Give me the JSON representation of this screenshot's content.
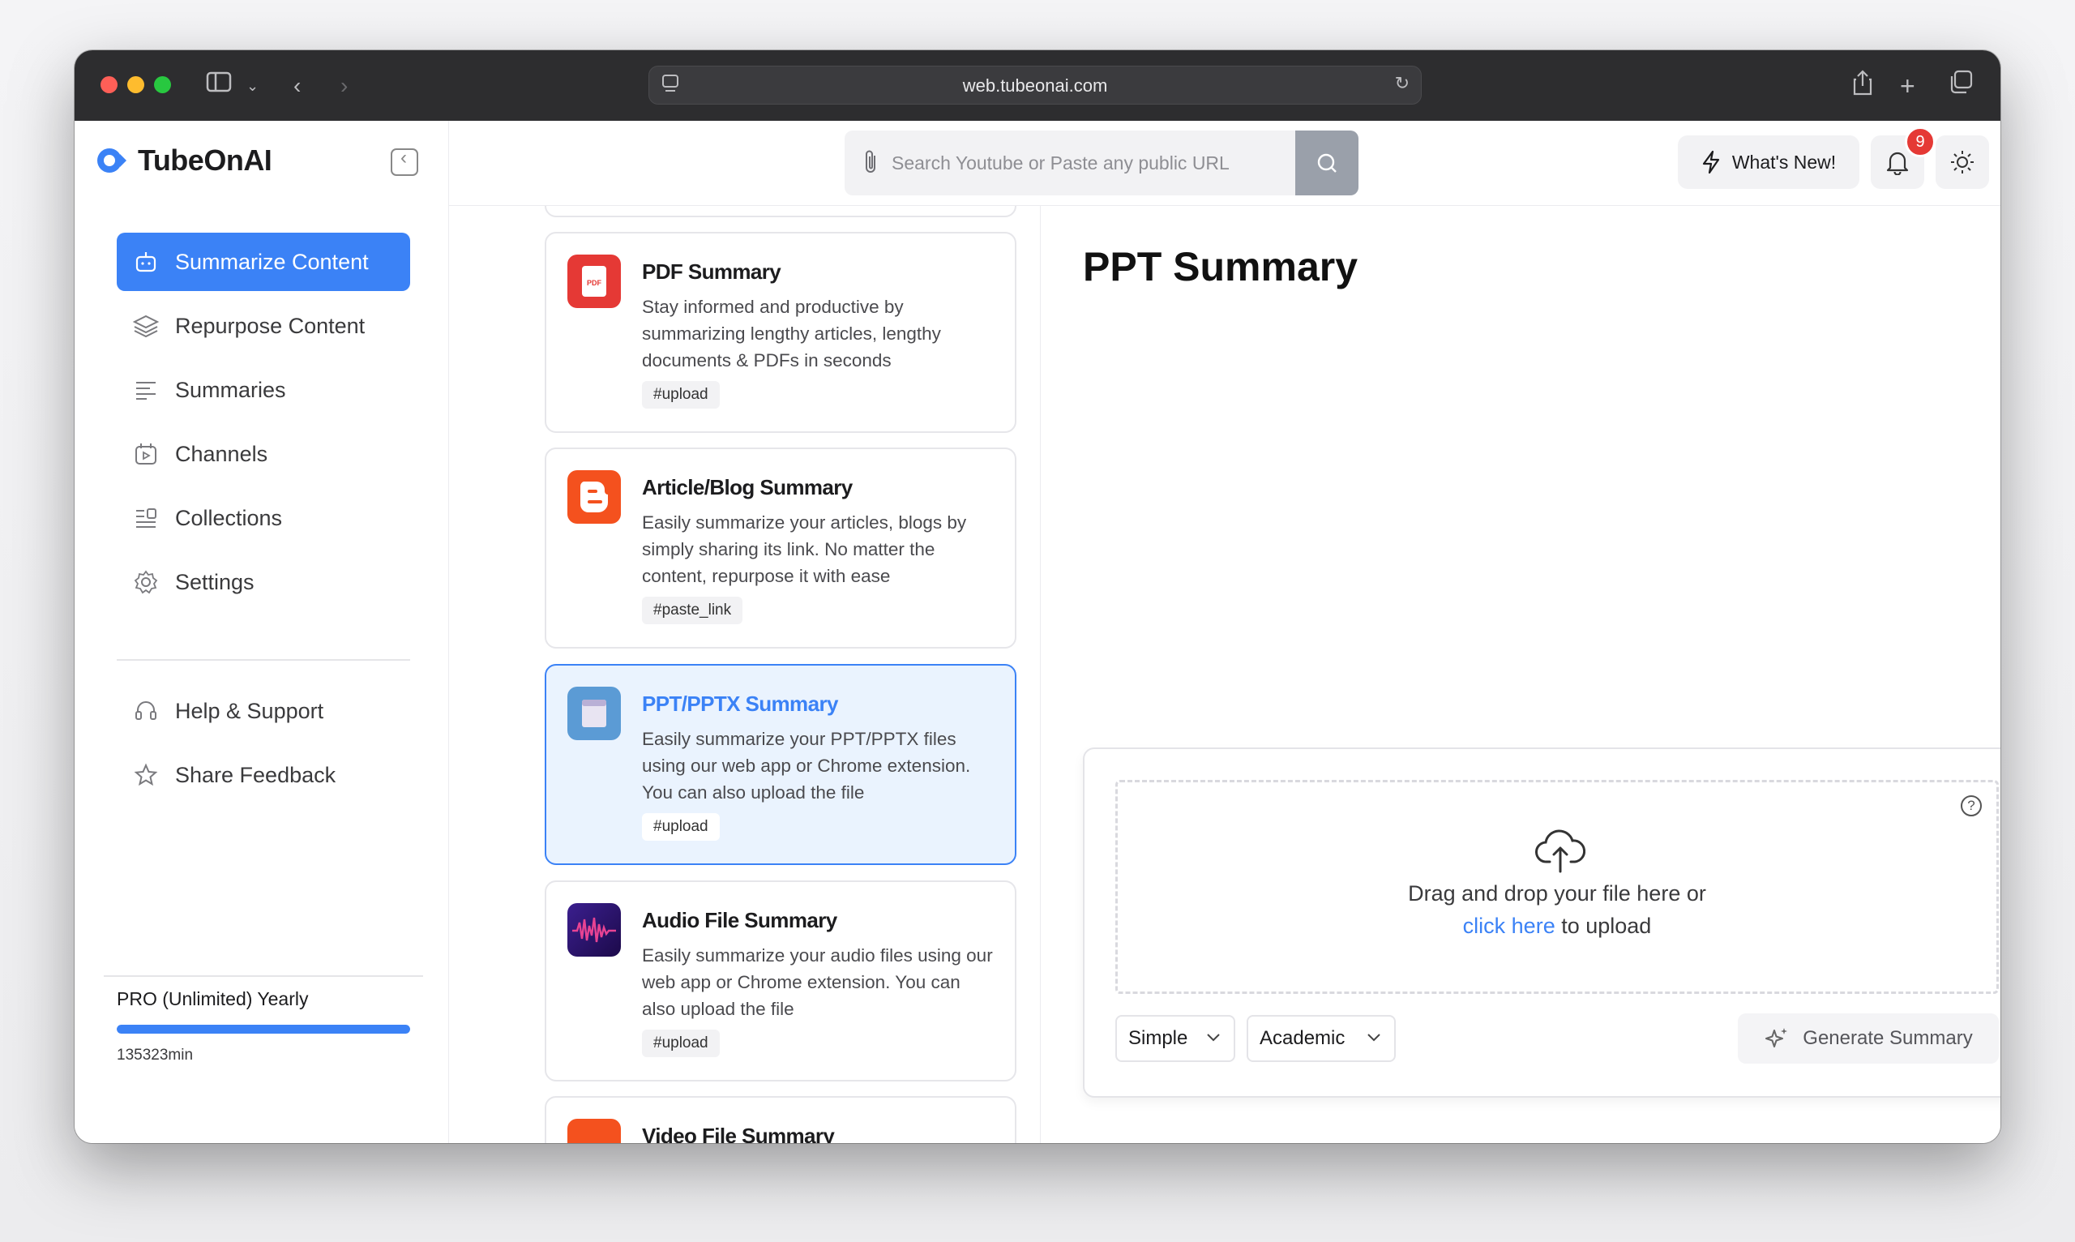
{
  "browser": {
    "url": "web.tubeonai.com"
  },
  "app": {
    "name": "TubeOnAI"
  },
  "sidebar": {
    "items": [
      {
        "label": "Summarize Content",
        "icon": "robot-icon",
        "active": true
      },
      {
        "label": "Repurpose Content",
        "icon": "layers-icon"
      },
      {
        "label": "Summaries",
        "icon": "list-icon"
      },
      {
        "label": "Channels",
        "icon": "channel-icon"
      },
      {
        "label": "Collections",
        "icon": "collection-icon"
      },
      {
        "label": "Settings",
        "icon": "gear-icon"
      }
    ],
    "secondary": [
      {
        "label": "Help & Support",
        "icon": "headset-icon"
      },
      {
        "label": "Share Feedback",
        "icon": "star-icon"
      }
    ],
    "plan": {
      "name": "PRO (Unlimited) Yearly",
      "progress": 1.0,
      "minutes": "135323min"
    }
  },
  "header": {
    "search_placeholder": "Search Youtube or Paste any public URL",
    "whats_new": "What's New!",
    "notification_count": "9"
  },
  "cards": [
    {
      "title": "PDF Summary",
      "description": "Stay informed and productive by summarizing lengthy articles, lengthy documents & PDFs in seconds",
      "tag": "#upload",
      "icon": "pdf-icon",
      "color": "#e53935"
    },
    {
      "title": "Article/Blog Summary",
      "description": "Easily summarize your articles, blogs by simply sharing its link. No matter the content, repurpose it with ease",
      "tag": "#paste_link",
      "icon": "blogger-icon",
      "color": "#f4511e"
    },
    {
      "title": "PPT/PPTX Summary",
      "description": "Easily summarize your PPT/PPTX files using our web app or Chrome extension. You can also upload the file",
      "tag": "#upload",
      "icon": "ppt-icon",
      "color": "#5b9bd5",
      "active": true
    },
    {
      "title": "Audio File Summary",
      "description": "Easily summarize your audio files using our web app or Chrome extension. You can also upload the file",
      "tag": "#upload",
      "icon": "audio-wave-icon",
      "color": "#5b1a8f"
    },
    {
      "title": "Video File Summary",
      "icon": "video-icon",
      "color": "#f4511e"
    }
  ],
  "main": {
    "title": "PPT Summary",
    "upload": {
      "line1": "Drag and drop your file here or",
      "link": "click here",
      "line2_suffix": " to upload"
    },
    "style_select": "Simple",
    "tone_select": "Academic",
    "generate_label": "Generate Summary"
  },
  "colors": {
    "accent": "#3b82f6",
    "badge": "#e53935"
  }
}
